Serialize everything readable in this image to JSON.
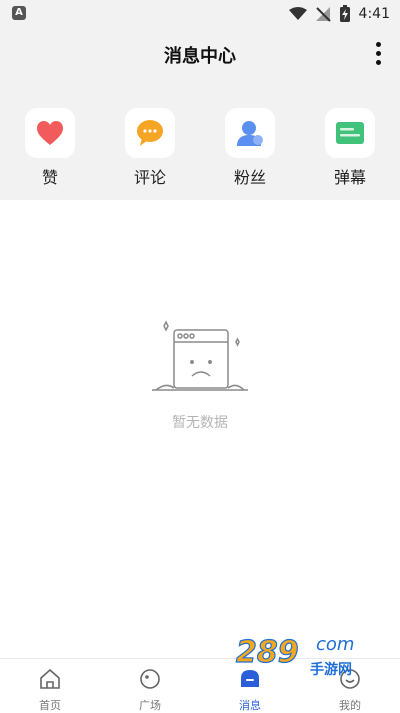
{
  "status": {
    "time": "4:41",
    "app_badge": "A"
  },
  "header": {
    "title": "消息中心",
    "more_icon": "more-vertical-icon"
  },
  "quick_actions": [
    {
      "label": "赞",
      "icon": "heart-icon",
      "color": "#f25b5b"
    },
    {
      "label": "评论",
      "icon": "comment-bubble-icon",
      "color": "#f5a524"
    },
    {
      "label": "粉丝",
      "icon": "user-icon",
      "color": "#5b8ff0"
    },
    {
      "label": "弹幕",
      "icon": "danmaku-icon",
      "color": "#41c27a"
    }
  ],
  "empty_state": {
    "text": "暂无数据",
    "icon": "empty-box-icon"
  },
  "tabbar": {
    "items": [
      {
        "label": "首页",
        "icon": "home-icon"
      },
      {
        "label": "广场",
        "icon": "plaza-icon"
      },
      {
        "label": "消息",
        "icon": "message-icon",
        "active": true
      },
      {
        "label": "我的",
        "icon": "profile-icon"
      }
    ],
    "active_color": "#2b5fd9"
  },
  "watermark": {
    "text_number": "289",
    "text_suffix": "com",
    "text_cn": "手游网"
  }
}
